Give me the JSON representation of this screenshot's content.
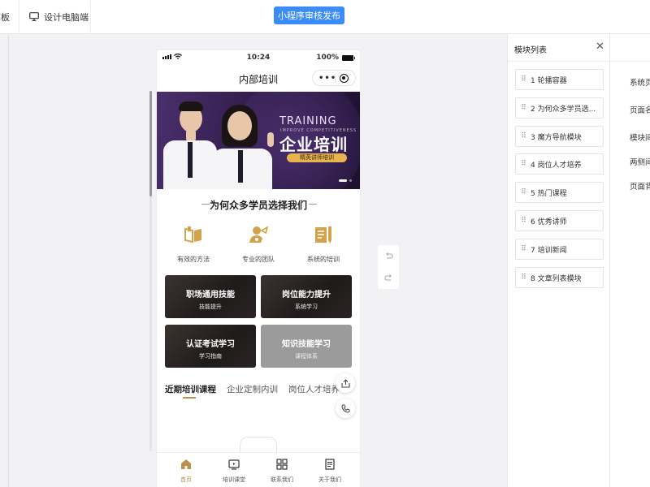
{
  "topbar": {
    "left_label": "模板",
    "design_label": "设计电脑端",
    "publish_label": "小程序审核发布"
  },
  "phone": {
    "status": {
      "time": "10:24",
      "battery": "100%"
    },
    "nav_title": "内部培训",
    "capsule_dots": "•••",
    "banner": {
      "title_en": "TRAINING",
      "subtitle_en": "IMPROVE COMPETITIVENESS",
      "title_cn": "企业培训",
      "pill": "精英讲师培训"
    },
    "section_title": "为何众多学员选择我们",
    "features": [
      {
        "label": "有效的方法",
        "icon": "book-icon"
      },
      {
        "label": "专业的团队",
        "icon": "team-icon"
      },
      {
        "label": "系统的培训",
        "icon": "document-icon"
      }
    ],
    "cards": [
      {
        "title": "职场通用技能",
        "subtitle": "技能提升"
      },
      {
        "title": "岗位能力提升",
        "subtitle": "系统学习"
      },
      {
        "title": "认证考试学习",
        "subtitle": "学习指南"
      },
      {
        "title": "知识技能学习",
        "subtitle": "课程体系"
      }
    ],
    "tabs": [
      "近期培训课程",
      "企业定制内训",
      "岗位人才培养"
    ],
    "bottom_tabs": [
      {
        "label": "首页",
        "icon": "home-icon"
      },
      {
        "label": "培训课堂",
        "icon": "video-icon"
      },
      {
        "label": "联系我们",
        "icon": "grid-icon"
      },
      {
        "label": "关于我们",
        "icon": "article-icon"
      }
    ],
    "accent": "#b8924a"
  },
  "module_panel": {
    "title": "模块列表",
    "close": "✕",
    "modules": [
      "1 轮播容器",
      "2 为何众多学员选...",
      "3 魔方导航模块",
      "4 岗位人才培养",
      "5 热门课程",
      "6 优秀讲师",
      "7 培训新闻",
      "8 文章列表模块"
    ]
  },
  "settings_panel": {
    "labels": [
      "系统页",
      "页面名",
      "模块间",
      "两侧间",
      "页面背"
    ]
  },
  "colors": {
    "primary_blue": "#3b8cf7",
    "gold": "#e7b44f"
  }
}
